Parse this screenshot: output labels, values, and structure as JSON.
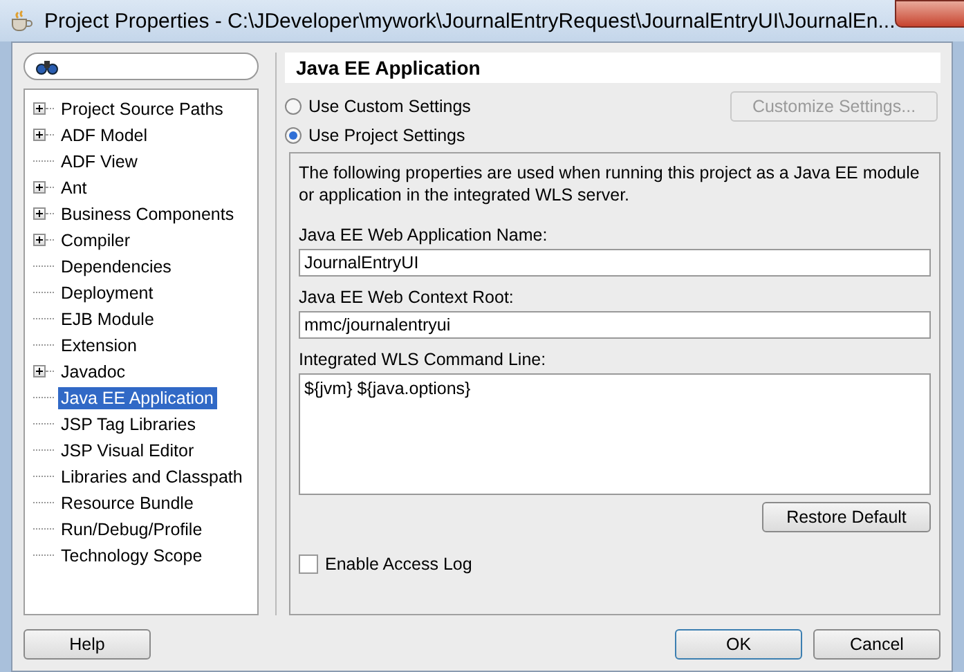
{
  "window": {
    "title": "Project Properties - C:\\JDeveloper\\mywork\\JournalEntryRequest\\JournalEntryUI\\JournalEn..."
  },
  "tree": [
    {
      "label": "Project Source Paths",
      "expandable": true,
      "selected": false
    },
    {
      "label": "ADF Model",
      "expandable": true,
      "selected": false
    },
    {
      "label": "ADF View",
      "expandable": false,
      "selected": false
    },
    {
      "label": "Ant",
      "expandable": true,
      "selected": false
    },
    {
      "label": "Business Components",
      "expandable": true,
      "selected": false
    },
    {
      "label": "Compiler",
      "expandable": true,
      "selected": false
    },
    {
      "label": "Dependencies",
      "expandable": false,
      "selected": false
    },
    {
      "label": "Deployment",
      "expandable": false,
      "selected": false
    },
    {
      "label": "EJB Module",
      "expandable": false,
      "selected": false
    },
    {
      "label": "Extension",
      "expandable": false,
      "selected": false
    },
    {
      "label": "Javadoc",
      "expandable": true,
      "selected": false
    },
    {
      "label": "Java EE Application",
      "expandable": false,
      "selected": true
    },
    {
      "label": "JSP Tag Libraries",
      "expandable": false,
      "selected": false
    },
    {
      "label": "JSP Visual Editor",
      "expandable": false,
      "selected": false
    },
    {
      "label": "Libraries and Classpath",
      "expandable": false,
      "selected": false
    },
    {
      "label": "Resource Bundle",
      "expandable": false,
      "selected": false
    },
    {
      "label": "Run/Debug/Profile",
      "expandable": false,
      "selected": false
    },
    {
      "label": "Technology Scope",
      "expandable": false,
      "selected": false
    }
  ],
  "page": {
    "title": "Java EE Application",
    "radios": [
      {
        "label": "Use Custom Settings",
        "selected": false
      },
      {
        "label": "Use Project Settings",
        "selected": true
      }
    ],
    "customize_button": {
      "label": "Customize Settings...",
      "disabled": true
    },
    "description": "The following properties are used when running this project as a Java EE module or application in the integrated WLS server.",
    "fields": [
      {
        "label": "Java EE Web Application Name:",
        "value": "JournalEntryUI"
      },
      {
        "label": "Java EE Web Context Root:",
        "value": "mmc/journalentryui"
      }
    ],
    "command_line": {
      "label": "Integrated WLS Command Line:",
      "value": "${jvm} ${java.options}"
    },
    "restore_button": "Restore Default",
    "access_log": {
      "label": "Enable Access Log",
      "checked": false
    }
  },
  "buttons": {
    "help": "Help",
    "ok": "OK",
    "cancel": "Cancel"
  }
}
